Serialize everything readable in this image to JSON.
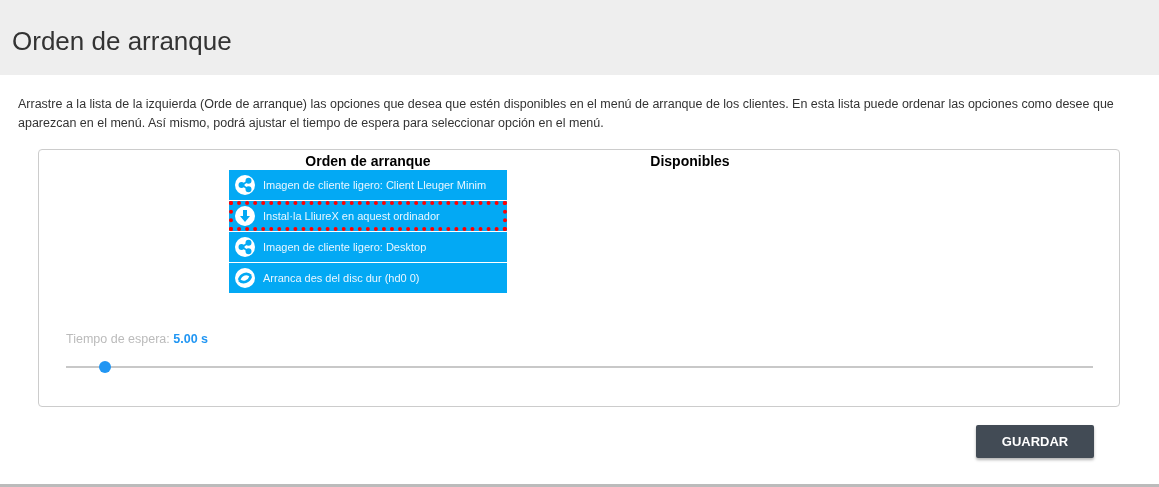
{
  "header": {
    "title": "Orden de arranque"
  },
  "description": "Arrastre a la lista de la izquierda (Orde de arranque) las opciones que desea que estén disponibles en el menú de arranque de los clientes. En esta lista puede ordenar las opciones como desee que aparezcan en el menú. Así mismo, podrá ajustar el tiempo de espera para seleccionar opción en el menú.",
  "boot_order": {
    "heading": "Orden de arranque",
    "items": [
      {
        "kind": "share",
        "label": "Imagen de cliente ligero: Client Lleuger Minim",
        "selected": false
      },
      {
        "kind": "download",
        "label": "Instal·la LliureX en aquest ordinador",
        "selected": true
      },
      {
        "kind": "share",
        "label": "Imagen de cliente ligero: Desktop",
        "selected": false
      },
      {
        "kind": "disk",
        "label": "Arranca des del disc dur (hd0 0)",
        "selected": false
      }
    ]
  },
  "available": {
    "heading": "Disponibles"
  },
  "timeout": {
    "label": "Tiempo de espera:",
    "value": "5.00 s",
    "level": 0.038
  },
  "save_button": "GUARDAR"
}
